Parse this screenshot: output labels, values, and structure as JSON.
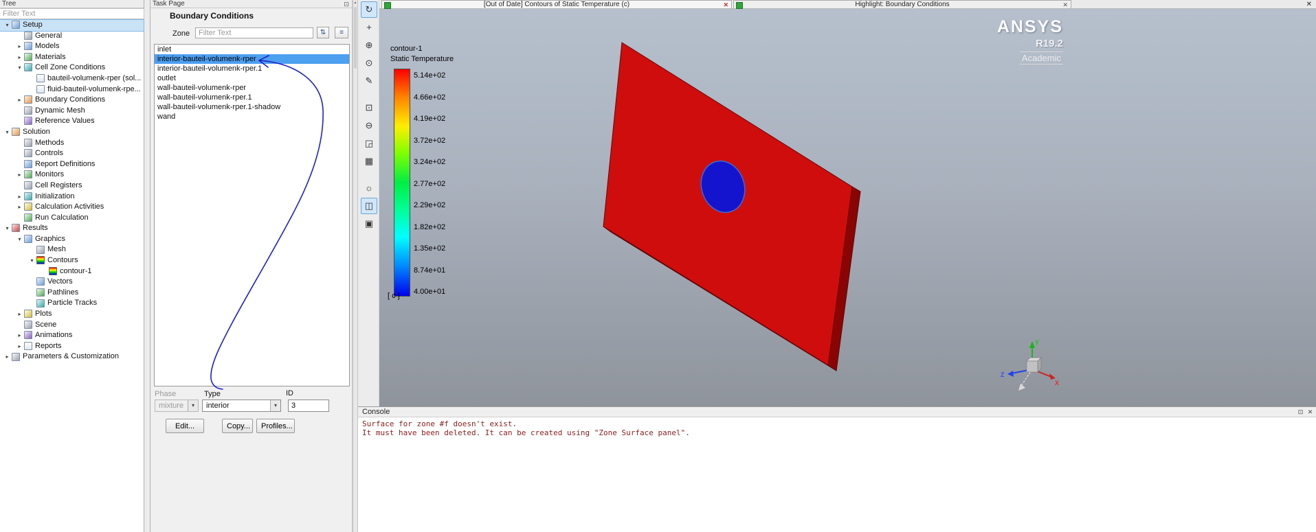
{
  "glyphs": {
    "dropdown": "▾",
    "scroll_up": "▲",
    "close": "✕",
    "restore": "⊡",
    "sort": "⇅",
    "menu": "≡"
  },
  "colors": {
    "plate_red": "#cf0d0d",
    "plate_edge_right": "#8a0404",
    "plate_edge_bottom": "#750303",
    "hole_blue": "#1414cf",
    "selection_blue": "#4d9ff0"
  },
  "tree": {
    "title": "Tree",
    "filter_placeholder": "Filter Text",
    "expander_open": "▾",
    "expander_closed": "▸",
    "items": [
      {
        "label": "Setup",
        "level": 0,
        "exp": "open",
        "icon": "setup-icon",
        "c": "blue",
        "selected": true
      },
      {
        "label": "General",
        "level": 1,
        "exp": null,
        "icon": "general-icon",
        "c": "gray"
      },
      {
        "label": "Models",
        "level": 1,
        "exp": "closed",
        "icon": "models-icon",
        "c": "blue"
      },
      {
        "label": "Materials",
        "level": 1,
        "exp": "closed",
        "icon": "materials-icon",
        "c": "green"
      },
      {
        "label": "Cell Zone Conditions",
        "level": 1,
        "exp": "open",
        "icon": "cell-zone-conditions-icon",
        "c": "teal"
      },
      {
        "label": "bauteil-volumenk-rper (sol...",
        "level": 2,
        "exp": null,
        "icon": "cell-zone-icon",
        "c": "doc"
      },
      {
        "label": "fluid-bauteil-volumenk-rpe...",
        "level": 2,
        "exp": null,
        "icon": "cell-zone-icon",
        "c": "doc"
      },
      {
        "label": "Boundary Conditions",
        "level": 1,
        "exp": "closed",
        "icon": "boundary-conditions-icon",
        "c": "orange"
      },
      {
        "label": "Dynamic Mesh",
        "level": 1,
        "exp": null,
        "icon": "dynamic-mesh-icon",
        "c": "gray"
      },
      {
        "label": "Reference Values",
        "level": 1,
        "exp": null,
        "icon": "reference-values-icon",
        "c": "purple"
      },
      {
        "label": "Solution",
        "level": 0,
        "exp": "open",
        "icon": "solution-icon",
        "c": "orange"
      },
      {
        "label": "Methods",
        "level": 1,
        "exp": null,
        "icon": "methods-icon",
        "c": "gray"
      },
      {
        "label": "Controls",
        "level": 1,
        "exp": null,
        "icon": "controls-icon",
        "c": "gray"
      },
      {
        "label": "Report Definitions",
        "level": 1,
        "exp": null,
        "icon": "report-definitions-icon",
        "c": "blue"
      },
      {
        "label": "Monitors",
        "level": 1,
        "exp": "closed",
        "icon": "monitors-icon",
        "c": "green"
      },
      {
        "label": "Cell Registers",
        "level": 1,
        "exp": null,
        "icon": "cell-registers-icon",
        "c": "gray"
      },
      {
        "label": "Initialization",
        "level": 1,
        "exp": "closed",
        "icon": "initialization-icon",
        "c": "teal"
      },
      {
        "label": "Calculation Activities",
        "level": 1,
        "exp": "closed",
        "icon": "calculation-activities-icon",
        "c": "yellow"
      },
      {
        "label": "Run Calculation",
        "level": 1,
        "exp": null,
        "icon": "run-calculation-icon",
        "c": "green"
      },
      {
        "label": "Results",
        "level": 0,
        "exp": "open",
        "icon": "results-icon",
        "c": "red"
      },
      {
        "label": "Graphics",
        "level": 1,
        "exp": "open",
        "icon": "graphics-icon",
        "c": "blue"
      },
      {
        "label": "Mesh",
        "level": 2,
        "exp": null,
        "icon": "mesh-icon",
        "c": "gray"
      },
      {
        "label": "Contours",
        "level": 2,
        "exp": "open",
        "icon": "contours-icon",
        "c": "rainbow"
      },
      {
        "label": "contour-1",
        "level": 3,
        "exp": null,
        "icon": "contour-icon",
        "c": "rainbow"
      },
      {
        "label": "Vectors",
        "level": 2,
        "exp": null,
        "icon": "vectors-icon",
        "c": "blue"
      },
      {
        "label": "Pathlines",
        "level": 2,
        "exp": null,
        "icon": "pathlines-icon",
        "c": "green"
      },
      {
        "label": "Particle Tracks",
        "level": 2,
        "exp": null,
        "icon": "particle-tracks-icon",
        "c": "teal"
      },
      {
        "label": "Plots",
        "level": 1,
        "exp": "closed",
        "icon": "plots-icon",
        "c": "yellow"
      },
      {
        "label": "Scene",
        "level": 1,
        "exp": null,
        "icon": "scene-icon",
        "c": "gray"
      },
      {
        "label": "Animations",
        "level": 1,
        "exp": "closed",
        "icon": "animations-icon",
        "c": "purple"
      },
      {
        "label": "Reports",
        "level": 1,
        "exp": "closed",
        "icon": "reports-icon",
        "c": "doc"
      },
      {
        "label": "Parameters & Customization",
        "level": 0,
        "exp": "closed",
        "icon": "parameters-customization-icon",
        "c": "gray"
      }
    ]
  },
  "task_page": {
    "header": "Task Page",
    "title": "Boundary Conditions",
    "zone_label": "Zone",
    "zone_filter_placeholder": "Filter Text",
    "zones": [
      "inlet",
      "interior-bauteil-volumenk-rper",
      "interior-bauteil-volumenk-rper.1",
      "outlet",
      "wall-bauteil-volumenk-rper",
      "wall-bauteil-volumenk-rper.1",
      "wall-bauteil-volumenk-rper.1-shadow",
      "wand"
    ],
    "selected_zone_index": 1,
    "phase": {
      "label": "Phase",
      "value": "mixture"
    },
    "type": {
      "label": "Type",
      "value": "interior"
    },
    "id_field": {
      "label": "ID",
      "value": "3"
    },
    "buttons": [
      "Edit...",
      "Copy...",
      "Profiles..."
    ]
  },
  "toolbar": {
    "buttons": [
      {
        "name": "rotate-view-icon",
        "glyph": "↻",
        "active": true
      },
      {
        "name": "pan-icon",
        "glyph": "+"
      },
      {
        "name": "zoom-in-box-icon",
        "glyph": "⊕"
      },
      {
        "name": "zoom-window-icon",
        "glyph": "⊙"
      },
      {
        "name": "probe-icon",
        "glyph": "✎"
      },
      {
        "spacer": true
      },
      {
        "name": "zoom-fit-icon",
        "glyph": "⊡"
      },
      {
        "name": "zoom-out-icon",
        "glyph": "⊖"
      },
      {
        "name": "resize-view-icon",
        "glyph": "◲"
      },
      {
        "name": "snap-grid-icon",
        "glyph": "▦"
      },
      {
        "spacer": true
      },
      {
        "name": "headlight-icon",
        "glyph": "☼"
      },
      {
        "name": "view-panel-icon",
        "glyph": "◫",
        "active": true
      },
      {
        "name": "copy-view-icon",
        "glyph": "▣"
      }
    ]
  },
  "graphics": {
    "tabs": [
      {
        "label": "[Out of Date] Contours of Static Temperature (c)"
      },
      {
        "label": "Highlight: Boundary Conditions"
      }
    ],
    "legend": {
      "title_line1": "contour-1",
      "title_line2": "Static Temperature",
      "unit": "[ c ]",
      "values": [
        "5.14e+02",
        "4.66e+02",
        "4.19e+02",
        "3.72e+02",
        "3.24e+02",
        "2.77e+02",
        "2.29e+02",
        "1.82e+02",
        "1.35e+02",
        "8.74e+01",
        "4.00e+01"
      ]
    },
    "logo": {
      "line1": "ANSYS",
      "line2": "R19.2",
      "line3": "Academic"
    },
    "triad": {
      "x": "X",
      "y": "Y",
      "z": "Z"
    }
  },
  "console": {
    "title": "Console",
    "lines": [
      "Surface for zone #f doesn't exist.",
      "It must have been deleted. It can be created using \"Zone Surface panel\"."
    ]
  }
}
